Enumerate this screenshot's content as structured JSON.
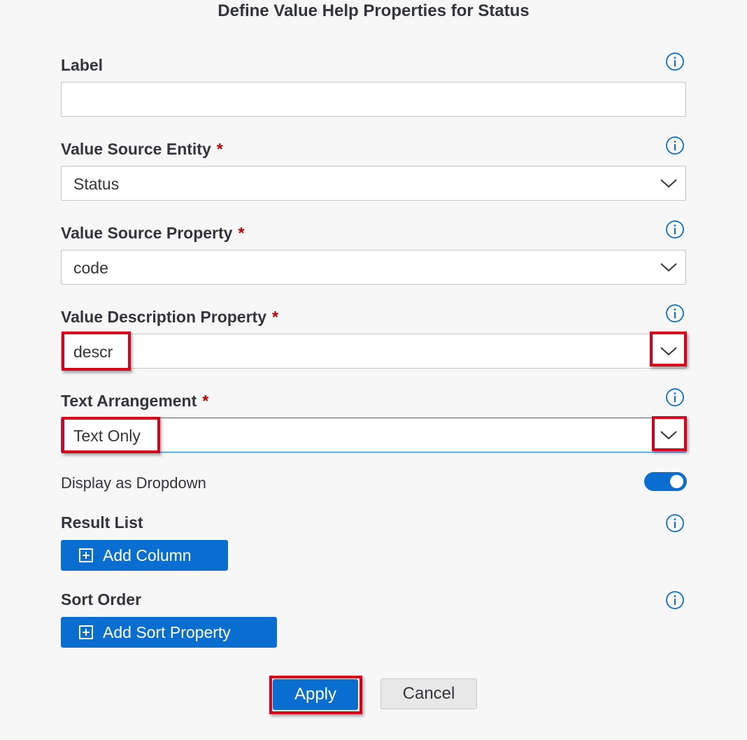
{
  "dialog": {
    "title": "Define Value Help Properties for Status"
  },
  "fields": {
    "label": {
      "label": "Label",
      "value": ""
    },
    "value_source_entity": {
      "label": "Value Source Entity",
      "required_mark": "*",
      "value": "Status"
    },
    "value_source_property": {
      "label": "Value Source Property",
      "required_mark": "*",
      "value": "code"
    },
    "value_description_property": {
      "label": "Value Description Property",
      "required_mark": "*",
      "value": "descr"
    },
    "text_arrangement": {
      "label": "Text Arrangement",
      "required_mark": "*",
      "value": "Text Only"
    }
  },
  "display_as_dropdown": {
    "label": "Display as Dropdown",
    "on": true
  },
  "result_list": {
    "label": "Result List",
    "add_button": "Add Column"
  },
  "sort_order": {
    "label": "Sort Order",
    "add_button": "Add Sort Property"
  },
  "footer": {
    "apply_label": "Apply",
    "cancel_label": "Cancel"
  },
  "icons": {
    "info": "info-icon",
    "chevron": "chevron-down-icon",
    "add": "plus-square-icon"
  },
  "colors": {
    "accent": "#0a6ed1",
    "required": "#bb0000",
    "highlight": "#d9001b"
  }
}
